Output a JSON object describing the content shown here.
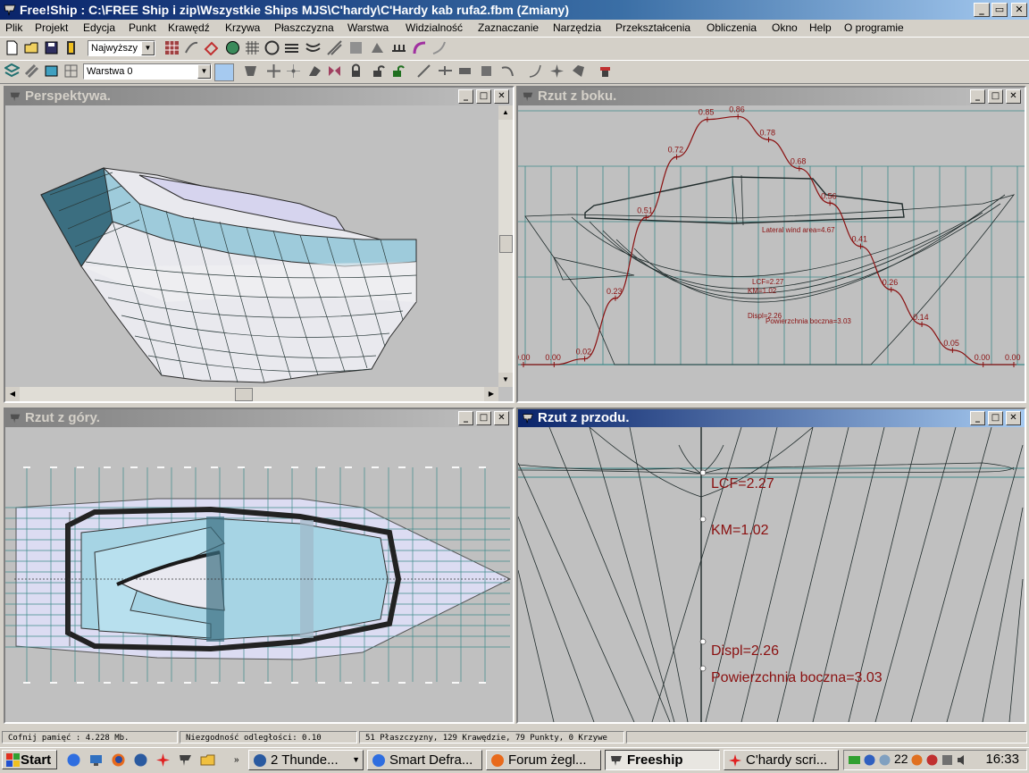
{
  "window": {
    "title": "Free!Ship  : C:\\FREE Ship i zip\\Wszystkie Ships MJS\\C'hardy\\C'Hardy kab rufa2.fbm (Zmiany)",
    "buttons": {
      "minimize": "_",
      "maximize": "▭",
      "close": "✕"
    }
  },
  "menu": [
    "Plik",
    "Projekt",
    "Edycja",
    "Punkt",
    "Krawędź",
    "Krzywa",
    "Płaszczyzna",
    "Warstwa",
    "Widzialność",
    "Zaznaczanie",
    "Narzędzia",
    "Przekształcenia",
    "Obliczenia",
    "Okno",
    "Help",
    "O programie"
  ],
  "toolbar": {
    "precision_select": "Najwyższy",
    "layer_select": "Warstwa 0"
  },
  "panels": {
    "perspective": {
      "title": "Perspektywa."
    },
    "side": {
      "title": "Rzut z boku.",
      "curve_labels": [
        "0.00",
        "0.00",
        "0.02",
        "0.23",
        "0.51",
        "0.72",
        "0.85",
        "0.86",
        "0.78",
        "0.68",
        "0.56",
        "0.41",
        "0.26",
        "0.14",
        "0.05",
        "0.00",
        "0.00"
      ],
      "lateral_wind": "Lateral wind area=4.67",
      "lcf": "LCF=2.27",
      "km": "KM=1.02",
      "displ": "Displ=2.26",
      "pow": "Powierzchnia boczna=3.03"
    },
    "top": {
      "title": "Rzut z góry."
    },
    "front": {
      "title": "Rzut z przodu.",
      "lcf": "LCF=2.27",
      "km": "KM=1.02",
      "displ": "Displ=2.26",
      "pow": "Powierzchnia boczna=3.03"
    }
  },
  "status": {
    "memory": "Cofnij pamięć : 4.228 Mb.",
    "tolerance": "Niezgodność odległości: 0.10",
    "counts": "51 Płaszczyzny, 129 Krawędzie, 79 Punkty, 0 Krzywe"
  },
  "taskbar": {
    "start": "Start",
    "buttons": [
      {
        "label": "2 Thunde...",
        "icon": "thunderbird-icon"
      },
      {
        "label": "Smart Defra...",
        "icon": "globe-icon"
      },
      {
        "label": "Forum żegl...",
        "icon": "firefox-icon"
      },
      {
        "label": "Freeship",
        "icon": "freeship-icon"
      },
      {
        "label": "C'hardy scri...",
        "icon": "star-icon"
      }
    ],
    "tray_temp": "22",
    "clock": "16:33"
  },
  "colors": {
    "title_active": "#0a246a",
    "hull_blue": "#9ccbdc",
    "curve_red": "#a01010",
    "grid_teal": "#3f8a8a"
  }
}
